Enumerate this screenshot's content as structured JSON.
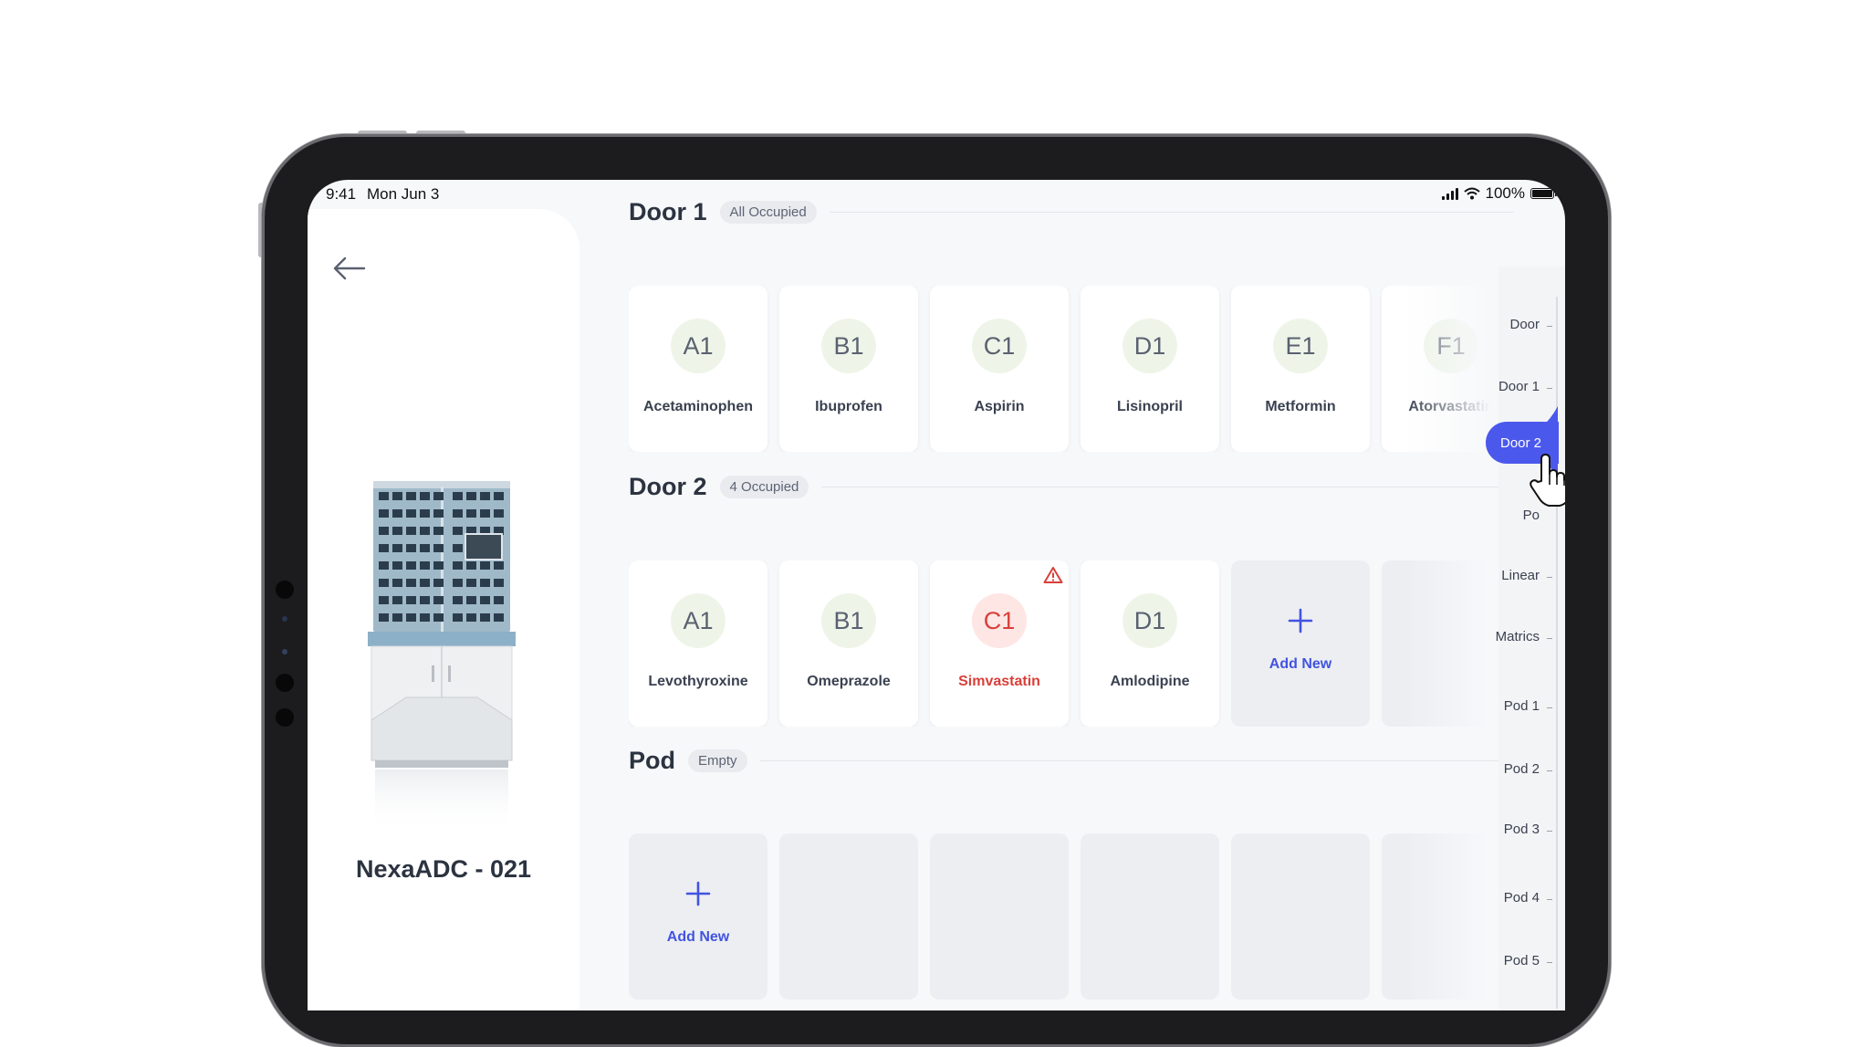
{
  "status_bar": {
    "time": "9:41",
    "date": "Mon Jun 3",
    "battery": "100%",
    "battery_level": 1.0
  },
  "device": {
    "name": "NexaADC - 021"
  },
  "sections": [
    {
      "title": "Door 1",
      "badge": "All Occupied",
      "slots": [
        {
          "code": "A1",
          "name": "Acetaminophen"
        },
        {
          "code": "B1",
          "name": "Ibuprofen"
        },
        {
          "code": "C1",
          "name": "Aspirin"
        },
        {
          "code": "D1",
          "name": "Lisinopril"
        },
        {
          "code": "E1",
          "name": "Metformin"
        },
        {
          "code": "F1",
          "name": "Atorvastatin"
        }
      ]
    },
    {
      "title": "Door 2",
      "badge": "4 Occupied",
      "slots": [
        {
          "code": "A1",
          "name": "Levothyroxine"
        },
        {
          "code": "B1",
          "name": "Omeprazole"
        },
        {
          "code": "C1",
          "name": "Simvastatin",
          "alert": true
        },
        {
          "code": "D1",
          "name": "Amlodipine"
        }
      ],
      "add_label": "Add New"
    },
    {
      "title": "Pod",
      "badge": "Empty",
      "add_label": "Add New"
    }
  ],
  "index": {
    "items": [
      "Door",
      "Door 1",
      "Door 2",
      "Po",
      "Linear",
      "Matrics",
      "Pod 1",
      "Pod 2",
      "Pod 3",
      "Pod 4",
      "Pod 5"
    ],
    "active": "Door 2"
  },
  "colors": {
    "accent": "#4b58ec",
    "alert": "#d8403a",
    "slot_bg": "#eef5e8"
  },
  "icons": {
    "back": "arrow-left-icon",
    "warning": "warning-triangle-icon",
    "add": "plus-icon",
    "cursor": "hand-pointer-icon"
  }
}
